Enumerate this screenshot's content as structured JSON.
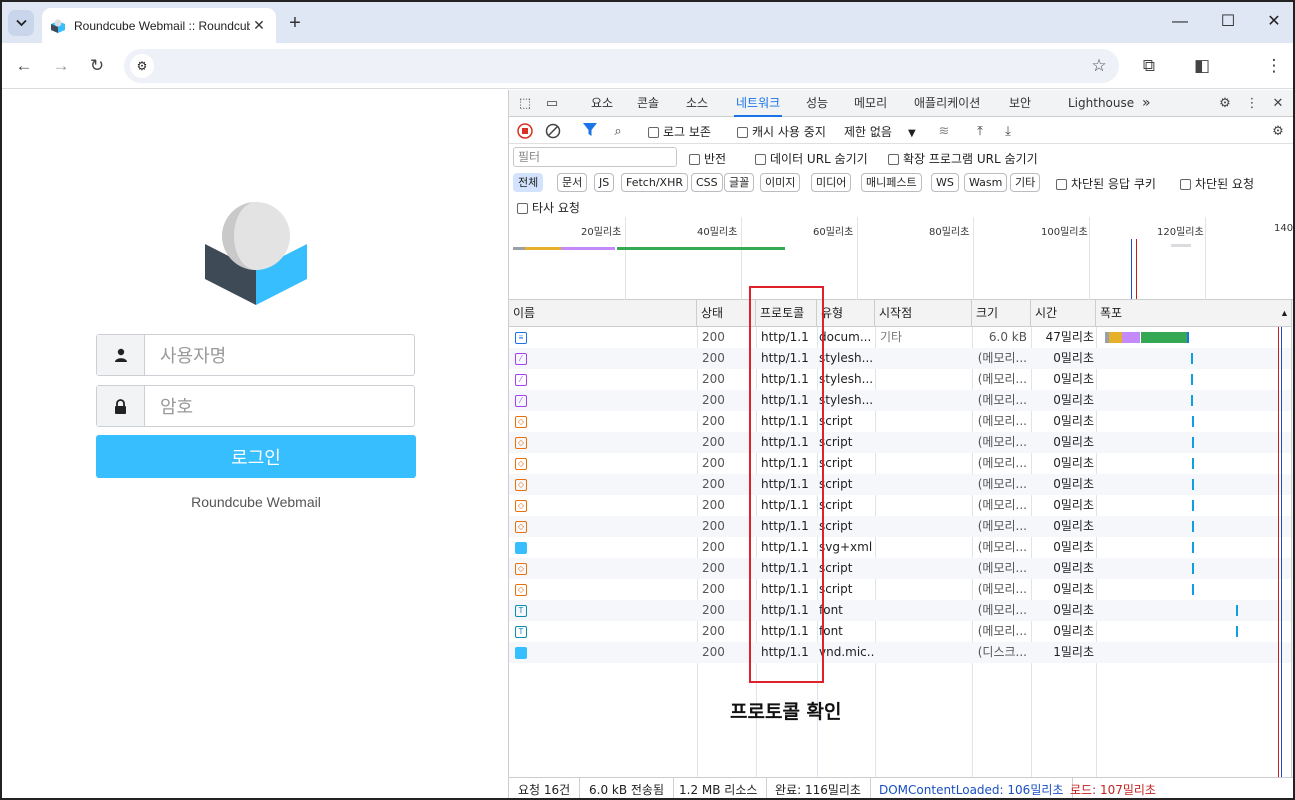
{
  "browser": {
    "tab_title": "Roundcube Webmail :: Roundcube Webmail",
    "tab_menu_icon": "chevron-down-icon",
    "new_tab_icon": "plus-icon",
    "window_controls": [
      "minimize-icon",
      "maximize-icon",
      "close-icon"
    ],
    "url": ""
  },
  "login": {
    "username_placeholder": "사용자명",
    "password_placeholder": "암호",
    "login_button": "로그인",
    "product_name": "Roundcube Webmail",
    "accent_color": "#37beff"
  },
  "devtools": {
    "tabs": [
      "요소",
      "콘솔",
      "소스",
      "네트워크",
      "성능",
      "메모리",
      "애플리케이션",
      "보안",
      "Lighthouse"
    ],
    "active_tab": "네트워크",
    "more_tabs": "»",
    "toolbar": {
      "preserve_log": "로그 보존",
      "disable_cache": "캐시 사용 중지",
      "throttling": "제한 없음"
    },
    "filter": {
      "placeholder": "필터",
      "invert": "반전",
      "hide_data_urls": "데이터 URL 숨기기",
      "hide_extension_urls": "확장 프로그램 URL 숨기기",
      "types": [
        "전체",
        "문서",
        "JS",
        "Fetch/XHR",
        "CSS",
        "글꼴",
        "이미지",
        "미디어",
        "매니페스트",
        "WS",
        "Wasm",
        "기타"
      ],
      "active_type": "전체",
      "blocked_cookies": "차단된 응답 쿠키",
      "blocked_requests": "차단된 요청",
      "third_party": "타사 요청"
    },
    "overview_ticks": [
      "20밀리초",
      "40밀리초",
      "60밀리초",
      "80밀리초",
      "100밀리초",
      "120밀리초",
      "140"
    ],
    "columns": [
      "이름",
      "상태",
      "프로토콜",
      "유형",
      "시작점",
      "크기",
      "시간",
      "폭포"
    ],
    "requests": [
      {
        "icon": "document-icon",
        "status": "200",
        "protocol": "http/1.1",
        "type": "docum...",
        "initiator": "기타",
        "size": "6.0 kB",
        "time": "47밀리초"
      },
      {
        "icon": "stylesheet-icon",
        "status": "200",
        "protocol": "http/1.1",
        "type": "stylesh...",
        "initiator": "",
        "size": "(메모리...",
        "time": "0밀리초"
      },
      {
        "icon": "stylesheet-icon",
        "status": "200",
        "protocol": "http/1.1",
        "type": "stylesh...",
        "initiator": "",
        "size": "(메모리...",
        "time": "0밀리초"
      },
      {
        "icon": "stylesheet-icon",
        "status": "200",
        "protocol": "http/1.1",
        "type": "stylesh...",
        "initiator": "",
        "size": "(메모리...",
        "time": "0밀리초"
      },
      {
        "icon": "script-icon",
        "status": "200",
        "protocol": "http/1.1",
        "type": "script",
        "initiator": "",
        "size": "(메모리...",
        "time": "0밀리초"
      },
      {
        "icon": "script-icon",
        "status": "200",
        "protocol": "http/1.1",
        "type": "script",
        "initiator": "",
        "size": "(메모리...",
        "time": "0밀리초"
      },
      {
        "icon": "script-icon",
        "status": "200",
        "protocol": "http/1.1",
        "type": "script",
        "initiator": "",
        "size": "(메모리...",
        "time": "0밀리초"
      },
      {
        "icon": "script-icon",
        "status": "200",
        "protocol": "http/1.1",
        "type": "script",
        "initiator": "",
        "size": "(메모리...",
        "time": "0밀리초"
      },
      {
        "icon": "script-icon",
        "status": "200",
        "protocol": "http/1.1",
        "type": "script",
        "initiator": "",
        "size": "(메모리...",
        "time": "0밀리초"
      },
      {
        "icon": "script-icon",
        "status": "200",
        "protocol": "http/1.1",
        "type": "script",
        "initiator": "",
        "size": "(메모리...",
        "time": "0밀리초"
      },
      {
        "icon": "image-icon",
        "status": "200",
        "protocol": "http/1.1",
        "type": "svg+xml",
        "initiator": "",
        "size": "(메모리...",
        "time": "0밀리초"
      },
      {
        "icon": "script-icon",
        "status": "200",
        "protocol": "http/1.1",
        "type": "script",
        "initiator": "",
        "size": "(메모리...",
        "time": "0밀리초"
      },
      {
        "icon": "script-icon",
        "status": "200",
        "protocol": "http/1.1",
        "type": "script",
        "initiator": "",
        "size": "(메모리...",
        "time": "0밀리초"
      },
      {
        "icon": "font-icon",
        "status": "200",
        "protocol": "http/1.1",
        "type": "font",
        "initiator": "",
        "size": "(메모리...",
        "time": "0밀리초"
      },
      {
        "icon": "font-icon",
        "status": "200",
        "protocol": "http/1.1",
        "type": "font",
        "initiator": "",
        "size": "(메모리...",
        "time": "0밀리초"
      },
      {
        "icon": "image-icon",
        "status": "200",
        "protocol": "http/1.1",
        "type": "vnd.mic...",
        "initiator": "",
        "size": "(디스크...",
        "time": "1밀리초"
      }
    ],
    "status": {
      "requests": "요청 16건",
      "transferred": "6.0 kB 전송됨",
      "resources": "1.2 MB 리소스",
      "finish": "완료: 116밀리초",
      "dom_content_loaded": "DOMContentLoaded: 106밀리초",
      "load": "로드: 107밀리초",
      "dcl_color": "#1a4fc4",
      "load_color": "#c5221f"
    }
  },
  "annotation": {
    "label": "프로토콜 확인",
    "color": "#e0202a"
  }
}
